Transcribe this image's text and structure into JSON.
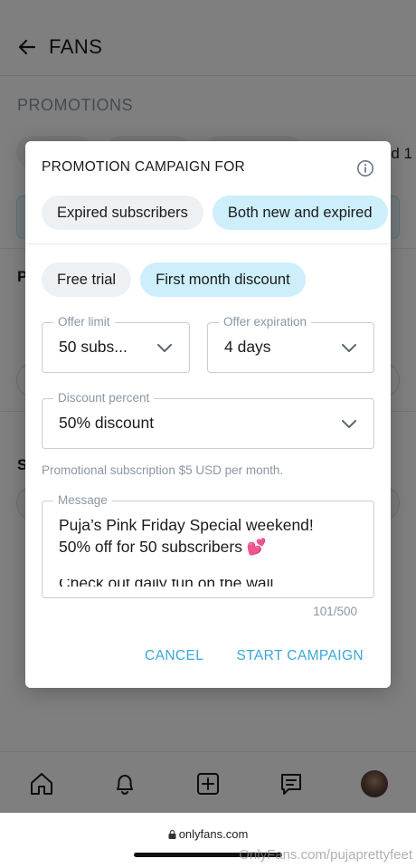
{
  "app": {
    "header_title": "FANS",
    "section_label": "PROMOTIONS",
    "partial_right_text": "d 1",
    "partial_p": "P",
    "partial_s": "S"
  },
  "modal": {
    "title": "PROMOTION CAMPAIGN FOR",
    "audience": {
      "options": [
        "Expired subscribers",
        "Both new and expired"
      ],
      "selected": "Both new and expired"
    },
    "type": {
      "options": [
        "Free trial",
        "First month discount"
      ],
      "selected": "First month discount"
    },
    "offer_limit": {
      "label": "Offer limit",
      "value": "50 subs..."
    },
    "offer_expiration": {
      "label": "Offer expiration",
      "value": "4 days"
    },
    "discount_percent": {
      "label": "Discount percent",
      "value": "50% discount"
    },
    "helper_text": "Promotional subscription $5 USD per month.",
    "message": {
      "label": "Message",
      "line1": "Puja’s Pink Friday Special weekend!",
      "line2": "50% off for 50 subscribers 💕",
      "line3": "Check out daily fun on the wall"
    },
    "char_counter": "101/500",
    "cancel_label": "CANCEL",
    "start_label": "START CAMPAIGN"
  },
  "browser": {
    "url": "onlyfans.com",
    "watermark": "OnlyFans.com/pujaprettyfeet"
  },
  "colors": {
    "accent": "#3aa6d8",
    "active_pill": "#cdeefb",
    "neutral_pill": "#eef1f3",
    "muted_text": "#8a96a3"
  }
}
